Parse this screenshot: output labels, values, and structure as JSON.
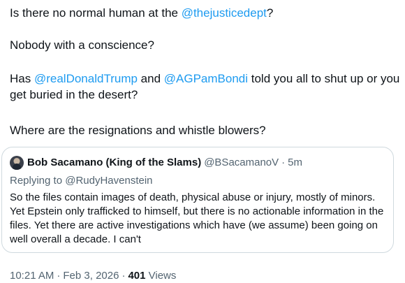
{
  "tweet": {
    "p1": {
      "before": "Is there no normal human at the ",
      "mention": "@thejusticedept",
      "after": "?"
    },
    "p2": "Nobody with a conscience?",
    "p3": {
      "before": "Has ",
      "mention1": "@realDonaldTrump",
      "middle": " and ",
      "mention2": "@AGPamBondi",
      "after": " told you all to shut up or you get buried in the desert?"
    },
    "p4": "Where are the resignations and whistle blowers?"
  },
  "quote": {
    "display_name": "Bob Sacamano (King of the Slams)",
    "handle": "@BSacamanoV",
    "separator": "·",
    "time": "5m",
    "replying_prefix": "Replying to ",
    "replying_handle": "@RudyHavenstein",
    "body": "So the files contain images of death, physical abuse or injury, mostly of minors. Yet Epstein only trafficked to himself, but there is no actionable information in the files. Yet there are active investigations which have (we assume) been going on well overall a decade. I can't"
  },
  "meta": {
    "time": "10:21 AM",
    "separator": "·",
    "date": "Feb 3, 2026",
    "views_count": "401",
    "views_label": " Views"
  },
  "colors": {
    "link": "#1d9bf0",
    "secondary_text": "#536471",
    "primary_text": "#0f1419",
    "border": "#cfd9de"
  },
  "icons": {
    "quote_avatar": "avatar"
  }
}
